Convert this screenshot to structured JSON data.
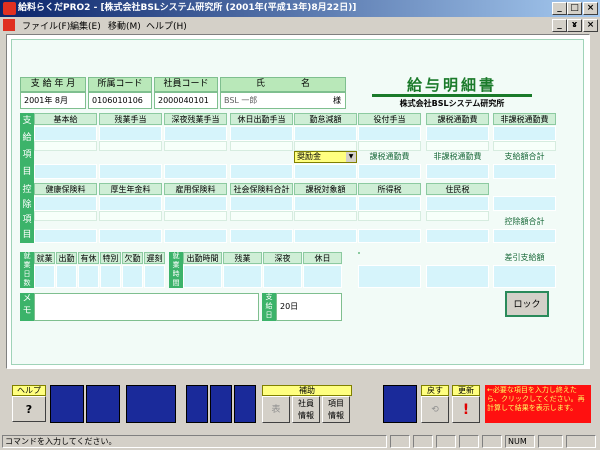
{
  "window": {
    "title": "給料らくだPRO2 - [株式会社BSLシステム研究所 (2001年(平成13年)8月22日)]",
    "min": "_",
    "max": "□",
    "close": "×",
    "restore": "ɤ"
  },
  "menu": [
    "ファイル(F)",
    "編集(E)",
    "移動(M)",
    "ヘルプ(H)"
  ],
  "header": {
    "pay_month_label": "支 給 年 月",
    "pay_month_value": "2001年 8月",
    "dept_label": "所属コード",
    "dept_value": "0106010106",
    "emp_label": "社員コード",
    "emp_value": "2000040101",
    "name_label": "氏　　　　名",
    "name_value": "BSL 一郎",
    "honorific": "様",
    "title": "給与明細書",
    "company": "株式会社BSLシステム研究所"
  },
  "pay_section": {
    "side": "支\n給\n項\n目",
    "headers_row1": [
      "基本給",
      "残業手当",
      "深夜残業手当",
      "休日出勤手当",
      "勤怠減額",
      "役付手当",
      "課税通勤費",
      "非課税通勤費"
    ],
    "dropdown_value": "奨励金",
    "headers_row2": [
      "課税通勤費",
      "非課税通勤費",
      "支給額合計"
    ]
  },
  "deduction_section": {
    "side": "控\n除\n項\n目",
    "headers": [
      "健康保険料",
      "厚生年金料",
      "雇用保険料",
      "社会保険料合計",
      "課税対象額",
      "所得税",
      "住民税"
    ],
    "total_label": "控除額合計"
  },
  "attendance": {
    "side": "就\n業\n日\n数",
    "headers": [
      "就業",
      "出勤",
      "有休",
      "特別",
      "欠勤",
      "遅刻"
    ],
    "time_side": "就\n業\n時\n間",
    "time_headers": [
      "出勤時間",
      "残業",
      "深夜",
      "休日"
    ],
    "net_label": "差引支給額"
  },
  "memo": {
    "label": "メ\nモ",
    "pay_day_label": "支\n給\n日",
    "pay_day_value": "20日"
  },
  "lock_button": "ロック",
  "toolbar": {
    "help_label": "ヘルプ",
    "help_icon": "?",
    "assist_label": "補助",
    "btn_table": "表",
    "btn_employee": "社員\n情報",
    "btn_item": "項目\n情報",
    "back_label": "戻す",
    "update_label": "更新",
    "message": "←必要な項目を入力し終えたら、クリックしてください。再計算して結果を表示します。"
  },
  "status": {
    "text": "コマンドを入力してください。",
    "num": "NUM"
  }
}
